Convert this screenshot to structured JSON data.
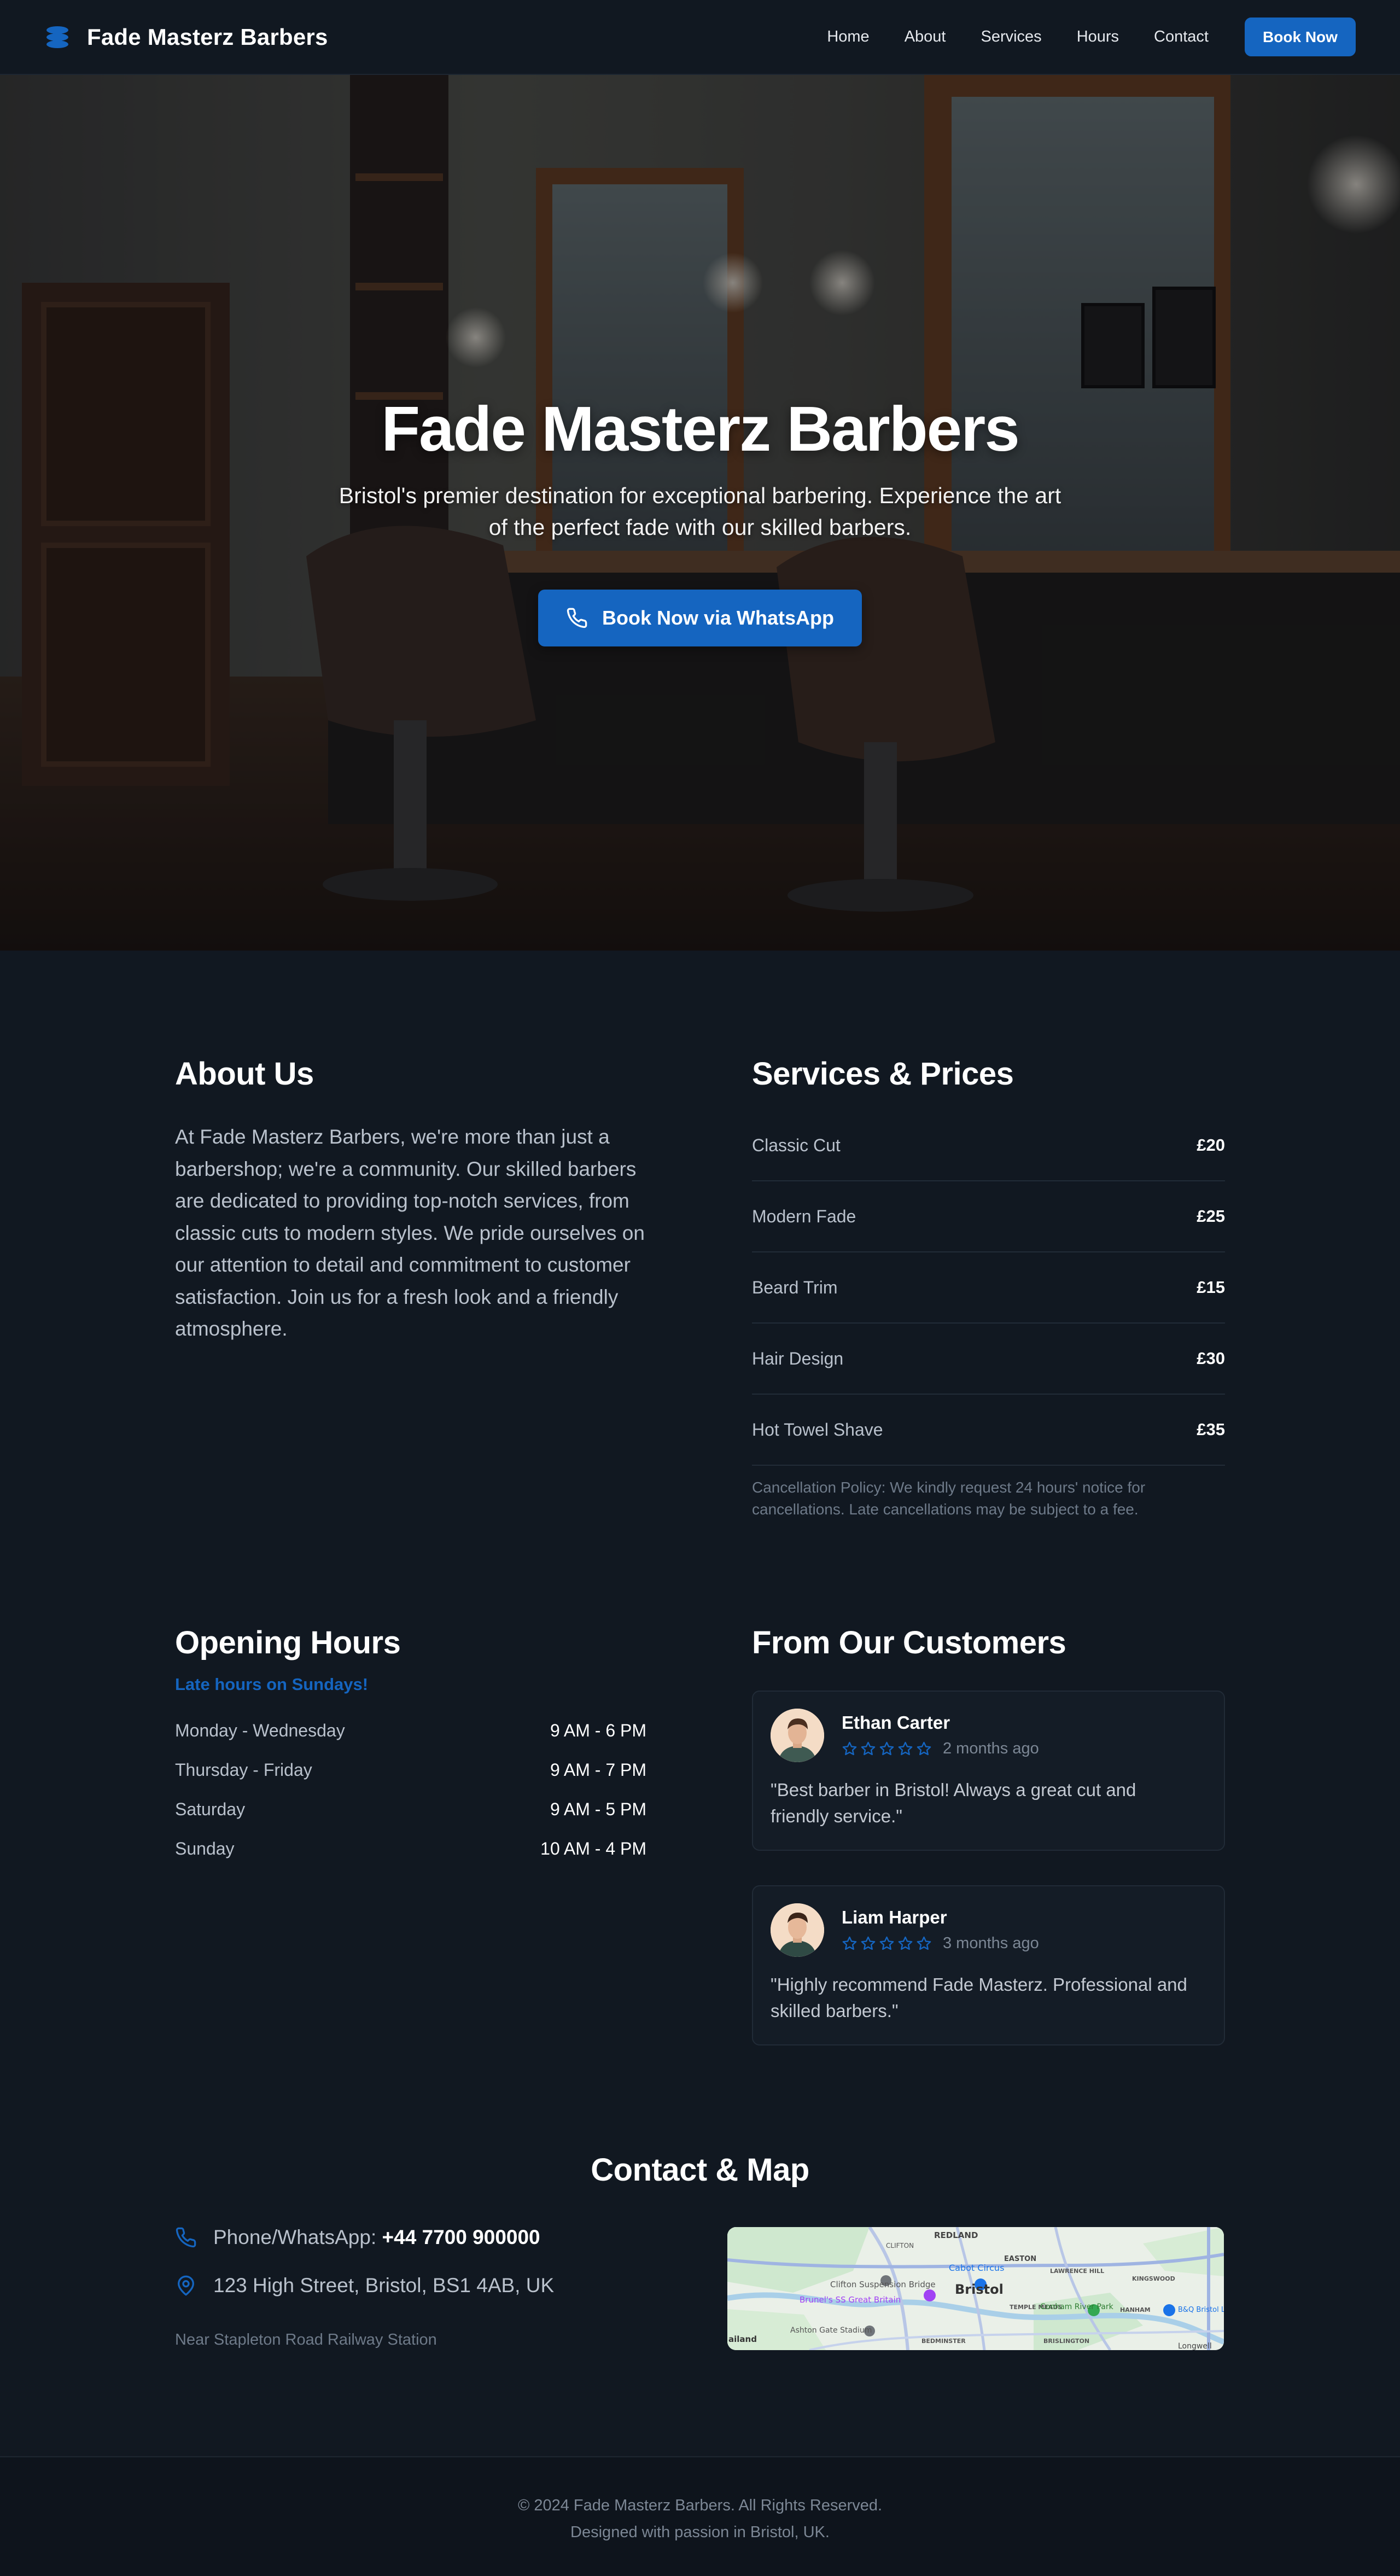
{
  "nav": {
    "brand": "Fade Masterz Barbers",
    "brand_icon": "barber-stack-icon",
    "links": [
      "Home",
      "About",
      "Services",
      "Hours",
      "Contact"
    ],
    "cta": "Book Now"
  },
  "hero": {
    "title": "Fade Masterz Barbers",
    "subtitle": "Bristol's premier destination for exceptional barbering. Experience the art of the perfect fade with our skilled barbers.",
    "cta": "Book Now via WhatsApp",
    "cta_icon": "phone-icon"
  },
  "about": {
    "title": "About Us",
    "text": "At Fade Masterz Barbers, we're more than just a barbershop; we're a community. Our skilled barbers are dedicated to providing top-notch services, from classic cuts to modern styles. We pride ourselves on our attention to detail and commitment to customer satisfaction. Join us for a fresh look and a friendly atmosphere."
  },
  "services": {
    "title": "Services & Prices",
    "items": [
      {
        "name": "Classic Cut",
        "price": "£20"
      },
      {
        "name": "Modern Fade",
        "price": "£25"
      },
      {
        "name": "Beard Trim",
        "price": "£15"
      },
      {
        "name": "Hair Design",
        "price": "£30"
      },
      {
        "name": "Hot Towel Shave",
        "price": "£35"
      }
    ],
    "policy": "Cancellation Policy: We kindly request 24 hours' notice for cancellations. Late cancellations may be subject to a fee."
  },
  "hours": {
    "title": "Opening Hours",
    "note": "Late hours on Sundays!",
    "rows": [
      {
        "day": "Monday - Wednesday",
        "time": "9 AM - 6 PM"
      },
      {
        "day": "Thursday - Friday",
        "time": "9 AM - 7 PM"
      },
      {
        "day": "Saturday",
        "time": "9 AM - 5 PM"
      },
      {
        "day": "Sunday",
        "time": "10 AM - 4 PM"
      }
    ]
  },
  "reviews": {
    "title": "From Our Customers",
    "items": [
      {
        "name": "Ethan Carter",
        "date": "2 months ago",
        "rating": 5,
        "text": "\"Best barber in Bristol! Always a great cut and friendly service.\""
      },
      {
        "name": "Liam Harper",
        "date": "3 months ago",
        "rating": 5,
        "text": "\"Highly recommend Fade Masterz. Professional and skilled barbers.\""
      }
    ]
  },
  "contact": {
    "title": "Contact & Map",
    "phone_label": "Phone/WhatsApp: ",
    "phone": "+44 7700 900000",
    "address": "123 High Street, Bristol, BS1 4AB, UK",
    "near": "Near Stapleton Road Railway Station",
    "map": {
      "labels": [
        "REDLAND",
        "CLIFTON",
        "Clifton Suspension Bridge",
        "Cabot Circus",
        "EASTON",
        "Bristol",
        "Brunel's SS Great Britain",
        "TEMPLE MEADS",
        "Conham River Park",
        "Ashton Gate Stadium",
        "BEDMINSTER",
        "BRISLINGTON",
        "B&Q Bristol Longwell",
        "Longwell",
        "KINGSWOOD",
        "HANHAM",
        "ailand",
        "LAWRENCE HILL"
      ]
    }
  },
  "footer": {
    "copyright": "© 2024 Fade Masterz Barbers. All Rights Reserved.",
    "tagline": "Designed with passion in Bristol, UK."
  },
  "colors": {
    "background": "#111821",
    "accent": "#1565c0",
    "card": "#141c26",
    "muted_text": "#b9c1cc"
  }
}
